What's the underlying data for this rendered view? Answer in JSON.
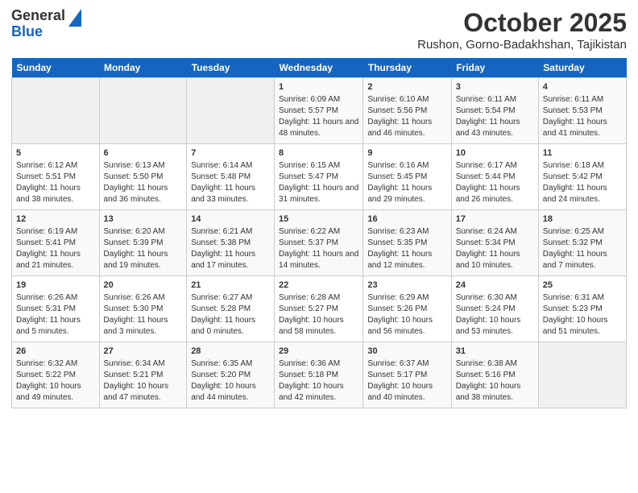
{
  "header": {
    "logo_line1": "General",
    "logo_line2": "Blue",
    "title": "October 2025",
    "subtitle": "Rushon, Gorno-Badakhshan, Tajikistan"
  },
  "days_of_week": [
    "Sunday",
    "Monday",
    "Tuesday",
    "Wednesday",
    "Thursday",
    "Friday",
    "Saturday"
  ],
  "weeks": [
    [
      {
        "day": "",
        "info": ""
      },
      {
        "day": "",
        "info": ""
      },
      {
        "day": "",
        "info": ""
      },
      {
        "day": "1",
        "info": "Sunrise: 6:09 AM\nSunset: 5:57 PM\nDaylight: 11 hours and 48 minutes."
      },
      {
        "day": "2",
        "info": "Sunrise: 6:10 AM\nSunset: 5:56 PM\nDaylight: 11 hours and 46 minutes."
      },
      {
        "day": "3",
        "info": "Sunrise: 6:11 AM\nSunset: 5:54 PM\nDaylight: 11 hours and 43 minutes."
      },
      {
        "day": "4",
        "info": "Sunrise: 6:11 AM\nSunset: 5:53 PM\nDaylight: 11 hours and 41 minutes."
      }
    ],
    [
      {
        "day": "5",
        "info": "Sunrise: 6:12 AM\nSunset: 5:51 PM\nDaylight: 11 hours and 38 minutes."
      },
      {
        "day": "6",
        "info": "Sunrise: 6:13 AM\nSunset: 5:50 PM\nDaylight: 11 hours and 36 minutes."
      },
      {
        "day": "7",
        "info": "Sunrise: 6:14 AM\nSunset: 5:48 PM\nDaylight: 11 hours and 33 minutes."
      },
      {
        "day": "8",
        "info": "Sunrise: 6:15 AM\nSunset: 5:47 PM\nDaylight: 11 hours and 31 minutes."
      },
      {
        "day": "9",
        "info": "Sunrise: 6:16 AM\nSunset: 5:45 PM\nDaylight: 11 hours and 29 minutes."
      },
      {
        "day": "10",
        "info": "Sunrise: 6:17 AM\nSunset: 5:44 PM\nDaylight: 11 hours and 26 minutes."
      },
      {
        "day": "11",
        "info": "Sunrise: 6:18 AM\nSunset: 5:42 PM\nDaylight: 11 hours and 24 minutes."
      }
    ],
    [
      {
        "day": "12",
        "info": "Sunrise: 6:19 AM\nSunset: 5:41 PM\nDaylight: 11 hours and 21 minutes."
      },
      {
        "day": "13",
        "info": "Sunrise: 6:20 AM\nSunset: 5:39 PM\nDaylight: 11 hours and 19 minutes."
      },
      {
        "day": "14",
        "info": "Sunrise: 6:21 AM\nSunset: 5:38 PM\nDaylight: 11 hours and 17 minutes."
      },
      {
        "day": "15",
        "info": "Sunrise: 6:22 AM\nSunset: 5:37 PM\nDaylight: 11 hours and 14 minutes."
      },
      {
        "day": "16",
        "info": "Sunrise: 6:23 AM\nSunset: 5:35 PM\nDaylight: 11 hours and 12 minutes."
      },
      {
        "day": "17",
        "info": "Sunrise: 6:24 AM\nSunset: 5:34 PM\nDaylight: 11 hours and 10 minutes."
      },
      {
        "day": "18",
        "info": "Sunrise: 6:25 AM\nSunset: 5:32 PM\nDaylight: 11 hours and 7 minutes."
      }
    ],
    [
      {
        "day": "19",
        "info": "Sunrise: 6:26 AM\nSunset: 5:31 PM\nDaylight: 11 hours and 5 minutes."
      },
      {
        "day": "20",
        "info": "Sunrise: 6:26 AM\nSunset: 5:30 PM\nDaylight: 11 hours and 3 minutes."
      },
      {
        "day": "21",
        "info": "Sunrise: 6:27 AM\nSunset: 5:28 PM\nDaylight: 11 hours and 0 minutes."
      },
      {
        "day": "22",
        "info": "Sunrise: 6:28 AM\nSunset: 5:27 PM\nDaylight: 10 hours and 58 minutes."
      },
      {
        "day": "23",
        "info": "Sunrise: 6:29 AM\nSunset: 5:26 PM\nDaylight: 10 hours and 56 minutes."
      },
      {
        "day": "24",
        "info": "Sunrise: 6:30 AM\nSunset: 5:24 PM\nDaylight: 10 hours and 53 minutes."
      },
      {
        "day": "25",
        "info": "Sunrise: 6:31 AM\nSunset: 5:23 PM\nDaylight: 10 hours and 51 minutes."
      }
    ],
    [
      {
        "day": "26",
        "info": "Sunrise: 6:32 AM\nSunset: 5:22 PM\nDaylight: 10 hours and 49 minutes."
      },
      {
        "day": "27",
        "info": "Sunrise: 6:34 AM\nSunset: 5:21 PM\nDaylight: 10 hours and 47 minutes."
      },
      {
        "day": "28",
        "info": "Sunrise: 6:35 AM\nSunset: 5:20 PM\nDaylight: 10 hours and 44 minutes."
      },
      {
        "day": "29",
        "info": "Sunrise: 6:36 AM\nSunset: 5:18 PM\nDaylight: 10 hours and 42 minutes."
      },
      {
        "day": "30",
        "info": "Sunrise: 6:37 AM\nSunset: 5:17 PM\nDaylight: 10 hours and 40 minutes."
      },
      {
        "day": "31",
        "info": "Sunrise: 6:38 AM\nSunset: 5:16 PM\nDaylight: 10 hours and 38 minutes."
      },
      {
        "day": "",
        "info": ""
      }
    ]
  ]
}
